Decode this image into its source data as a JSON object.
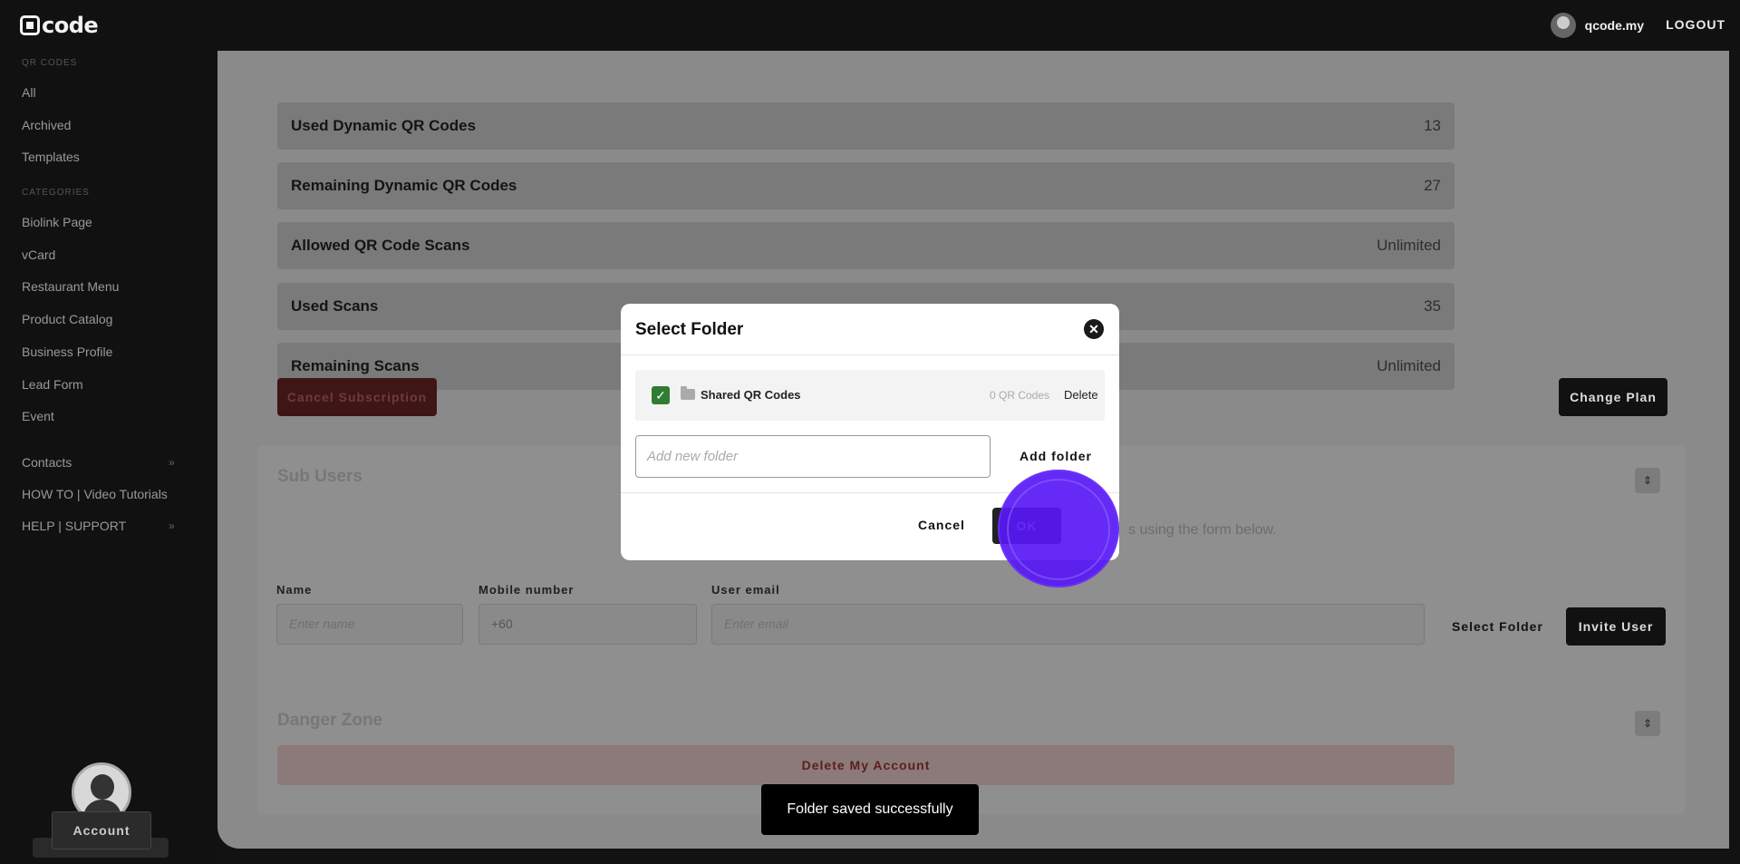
{
  "app": {
    "logo_text": "code",
    "user_name": "qcode.my",
    "logout_label": "LOGOUT"
  },
  "sidebar": {
    "qr_heading": "QR CODES",
    "qr_items": [
      "All",
      "Archived",
      "Templates"
    ],
    "categories_heading": "CATEGORIES",
    "category_items": [
      "Biolink Page",
      "vCard",
      "Restaurant Menu",
      "Product Catalog",
      "Business Profile",
      "Lead Form",
      "Event"
    ],
    "bottom_items": [
      {
        "label": "Contacts",
        "chevron": "»"
      },
      {
        "label": "HOW TO | Video Tutorials",
        "chevron": ""
      },
      {
        "label": "HELP | SUPPORT",
        "chevron": "»"
      }
    ],
    "account_label": "Account"
  },
  "plan": {
    "rows": [
      {
        "label": "Used Dynamic QR Codes",
        "value": "13"
      },
      {
        "label": "Remaining Dynamic QR Codes",
        "value": "27"
      },
      {
        "label": "Allowed QR Code Scans",
        "value": "Unlimited"
      },
      {
        "label": "Used Scans",
        "value": "35"
      },
      {
        "label": "Remaining Scans",
        "value": "Unlimited"
      }
    ],
    "cancel_subscription_label": "Cancel Subscription",
    "change_plan_label": "Change Plan"
  },
  "sub_users": {
    "title": "Sub Users",
    "description": "s using the form below.",
    "name_label": "Name",
    "name_placeholder": "Enter name",
    "mobile_label": "Mobile number",
    "mobile_value": "+60",
    "email_label": "User email",
    "email_placeholder": "Enter email",
    "select_folder_label": "Select Folder",
    "invite_label": "Invite User"
  },
  "danger_zone": {
    "title": "Danger Zone",
    "delete_label": "Delete My Account"
  },
  "modal": {
    "title": "Select Folder",
    "close_glyph": "✕",
    "folder": {
      "name": "Shared QR Codes",
      "count": "0 QR Codes",
      "delete_label": "Delete",
      "checked": true
    },
    "add_placeholder": "Add new folder",
    "add_folder_label": "Add folder",
    "cancel_label": "Cancel",
    "ok_label": "OK"
  },
  "toast": {
    "message": "Folder saved successfully"
  },
  "colors": {
    "ok_highlight": "#5818f5",
    "check_green": "#2e7d32"
  }
}
